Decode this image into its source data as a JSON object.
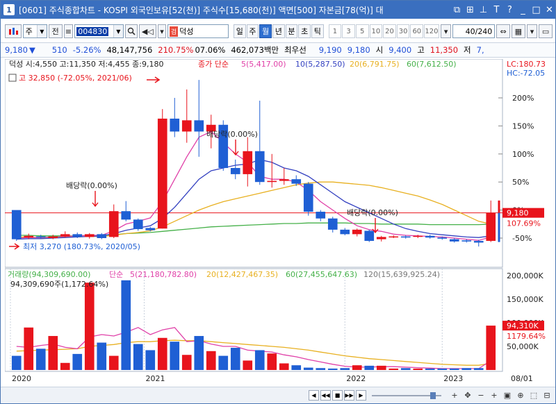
{
  "window": {
    "number": "1",
    "title": "[0601] 주식종합차트 - KOSPI 외국인보유[52(천)] 주식수[15,680(천)] 액면[500] 자본금[78(억)] 대"
  },
  "toolbar": {
    "market_type": "주",
    "prev_label": "전",
    "stock_code": "004830",
    "stock_badge": "검",
    "stock_name": "덕성",
    "periods": [
      "일",
      "주",
      "월",
      "년",
      "분",
      "초",
      "틱"
    ],
    "active_period": "월",
    "numbers": [
      "1",
      "3",
      "5",
      "10",
      "20",
      "30",
      "60",
      "120"
    ],
    "count": "40/240"
  },
  "quote": {
    "price": "9,180",
    "change_arrow": "▼",
    "change": "510",
    "change_pct": "-5.26%",
    "volume": "48,147,756",
    "volume_ratio": "210.75%",
    "turnover": "07.06%",
    "amount": "462,073백만",
    "pref_label": "최우선",
    "ask": "9,190",
    "bid": "9,180",
    "open_label": "시",
    "open": "9,400",
    "high_label": "고",
    "high": "11,350",
    "low_label": "저",
    "low": "7,"
  },
  "legend": {
    "ohlc": "덕성 시:4,550 고:11,350 저:4,455 종:9,180",
    "close_label": "종가 단순",
    "ma5": "5(5,417.00)",
    "ma10": "10(5,287.50)",
    "ma20": "20(6,791.75)",
    "ma60": "60(7,612.50)",
    "high_note": "고 32,850 (-72.05%, 2021/06)",
    "low_note": "최저 3,270 (180.73%, 2020/05)",
    "dividend": "배당락(0.00%)",
    "lc": "LC:180.73",
    "hc": "HC:-72.05",
    "vol_title": "거래량(94,309,690.00)",
    "vol_ma_label": "단순",
    "vol_ma5": "5(21,180,782.80)",
    "vol_ma20": "20(12,427,467.35)",
    "vol_ma60": "60(27,455,647.63)",
    "vol_ma120": "120(15,639,925.24)",
    "vol_note": "94,309,690주(1,172.64%)"
  },
  "colors": {
    "up": "#e8141c",
    "down": "#1f5fd4",
    "ma5": "#e040a8",
    "ma10": "#3340c0",
    "ma20": "#e8b020",
    "ma60": "#44b048",
    "ma120": "#777777",
    "price_line": "#e8141c"
  },
  "chart_data": {
    "type": "candlestick",
    "x_labels": [
      "2020",
      "2021",
      "2022",
      "2023",
      "08/01"
    ],
    "price_axis": [
      "200%",
      "150%",
      "100%",
      "50%",
      "0%",
      "-50%"
    ],
    "current_price_label": "9,180",
    "current_pct_label": "107.69%",
    "volume_axis": [
      "200,000K",
      "150,000K",
      "100,000K",
      "50,000K"
    ],
    "current_volume_label": "94,310K",
    "current_volume_pct": "1179.64%",
    "candles": [
      {
        "o": 0.0,
        "c": -52,
        "h": -46,
        "l": -55
      },
      {
        "o": -49,
        "c": -46,
        "h": -42,
        "l": -52
      },
      {
        "o": -47,
        "c": -49,
        "h": -44,
        "l": -51
      },
      {
        "o": -50,
        "c": -47,
        "h": -44,
        "l": -52
      },
      {
        "o": -47,
        "c": -43,
        "h": -38,
        "l": -49
      },
      {
        "o": -43,
        "c": -48,
        "h": -40,
        "l": -50
      },
      {
        "o": -48,
        "c": -43,
        "h": -41,
        "l": -51
      },
      {
        "o": -43,
        "c": -50,
        "h": -41,
        "l": -52
      },
      {
        "o": -48,
        "c": -2,
        "h": 10,
        "l": -50
      },
      {
        "o": -2,
        "c": -17,
        "h": 16,
        "l": -20
      },
      {
        "o": -17,
        "c": -34,
        "h": -15,
        "l": -37
      },
      {
        "o": -32,
        "c": -36,
        "h": -30,
        "l": -38
      },
      {
        "o": -33,
        "c": 163,
        "h": 180,
        "l": -33
      },
      {
        "o": 163,
        "c": 140,
        "h": 200,
        "l": 130
      },
      {
        "o": 140,
        "c": 160,
        "h": 215,
        "l": 120
      },
      {
        "o": 160,
        "c": 140,
        "h": 232,
        "l": 95
      },
      {
        "o": 140,
        "c": 152,
        "h": 170,
        "l": 110
      },
      {
        "o": 152,
        "c": 75,
        "h": 160,
        "l": 70
      },
      {
        "o": 75,
        "c": 64,
        "h": 90,
        "l": 55
      },
      {
        "o": 64,
        "c": 105,
        "h": 130,
        "l": 42
      },
      {
        "o": 105,
        "c": 50,
        "h": 195,
        "l": 45
      },
      {
        "o": 50,
        "c": 52,
        "h": 100,
        "l": 40
      },
      {
        "o": 52,
        "c": 55,
        "h": 75,
        "l": 45
      },
      {
        "o": 55,
        "c": 47,
        "h": 62,
        "l": 43
      },
      {
        "o": 47,
        "c": -3,
        "h": 50,
        "l": -10
      },
      {
        "o": -3,
        "c": -15,
        "h": 0,
        "l": -20
      },
      {
        "o": -15,
        "c": -35,
        "h": -12,
        "l": -40
      },
      {
        "o": -35,
        "c": -43,
        "h": -32,
        "l": -45
      },
      {
        "o": -43,
        "c": -35,
        "h": -33,
        "l": -47
      },
      {
        "o": -37,
        "c": -55,
        "h": -35,
        "l": -57
      },
      {
        "o": -52,
        "c": -48,
        "h": -46,
        "l": -56
      },
      {
        "o": -48,
        "c": -47,
        "h": -45,
        "l": -50
      },
      {
        "o": -47,
        "c": -49,
        "h": -45,
        "l": -51
      },
      {
        "o": -47,
        "c": -46,
        "h": -44,
        "l": -50
      },
      {
        "o": -46,
        "c": -49,
        "h": -44,
        "l": -51
      },
      {
        "o": -49,
        "c": -51,
        "h": -47,
        "l": -53
      },
      {
        "o": -52,
        "c": -56,
        "h": -50,
        "l": -58
      },
      {
        "o": -54,
        "c": -56,
        "h": -52,
        "l": -58
      },
      {
        "o": -55,
        "c": -58,
        "h": -53,
        "l": -65
      },
      {
        "o": -55,
        "c": -5,
        "h": 17,
        "l": -57
      }
    ],
    "volumes": [
      30,
      90,
      45,
      72,
      15,
      34,
      185,
      58,
      30,
      190,
      55,
      42,
      68,
      60,
      32,
      72,
      40,
      30,
      47,
      20,
      42,
      35,
      14,
      10,
      5,
      4,
      3,
      4,
      10,
      9,
      9,
      3,
      4,
      3,
      3,
      3,
      3,
      4,
      4,
      94
    ],
    "ma5": [
      -50,
      -49,
      -49,
      -48,
      -47,
      -46,
      -45,
      -45,
      -37,
      -25,
      -20,
      -14,
      15,
      55,
      95,
      130,
      140,
      120,
      100,
      85,
      60,
      55,
      55,
      50,
      35,
      15,
      0,
      -15,
      -28,
      -35,
      -38,
      -43,
      -45,
      -46,
      -47,
      -48,
      -50,
      -52,
      -54,
      -48
    ],
    "ma10": [
      -52,
      -51,
      -51,
      -50,
      -49,
      -48,
      -47,
      -46,
      -42,
      -36,
      -32,
      -28,
      -15,
      5,
      30,
      55,
      70,
      75,
      80,
      82,
      90,
      85,
      75,
      70,
      60,
      45,
      30,
      15,
      5,
      -5,
      -15,
      -25,
      -33,
      -38,
      -42,
      -44,
      -46,
      -48,
      -49,
      -46
    ],
    "ma20": [
      -48,
      -48,
      -49,
      -49,
      -48,
      -48,
      -47,
      -47,
      -45,
      -42,
      -40,
      -37,
      -30,
      -20,
      -10,
      0,
      8,
      15,
      20,
      25,
      30,
      35,
      40,
      45,
      48,
      50,
      50,
      48,
      46,
      44,
      40,
      35,
      30,
      25,
      18,
      10,
      0,
      -10,
      -20,
      -25
    ],
    "ma60": [
      -45,
      -45,
      -46,
      -46,
      -46,
      -46,
      -45,
      -45,
      -44,
      -42,
      -41,
      -40,
      -38,
      -36,
      -34,
      -32,
      -30,
      -29,
      -28,
      -27,
      -26,
      -25,
      -24,
      -24,
      -23,
      -23,
      -23,
      -23,
      -24,
      -24,
      -25,
      -25,
      -25,
      -25,
      -26,
      -26,
      -26,
      -26,
      -26,
      -25
    ],
    "vma5": [
      50,
      48,
      52,
      55,
      48,
      45,
      70,
      75,
      72,
      80,
      90,
      75,
      85,
      90,
      60,
      62,
      55,
      50,
      50,
      42,
      40,
      38,
      32,
      28,
      22,
      17,
      12,
      8,
      6,
      6,
      7,
      7,
      6,
      5,
      4,
      3,
      3,
      3,
      3,
      20
    ],
    "vma20": [
      40,
      41,
      42,
      43,
      44,
      45,
      50,
      52,
      54,
      58,
      60,
      60,
      62,
      63,
      62,
      62,
      60,
      58,
      56,
      54,
      52,
      50,
      48,
      45,
      42,
      38,
      34,
      30,
      27,
      24,
      22,
      20,
      18,
      16,
      14,
      12,
      11,
      10,
      10,
      14
    ]
  },
  "bottom": {
    "nav": [
      "◀",
      "◀◀",
      "■",
      "▶▶",
      "▶"
    ],
    "tools": [
      "+",
      "✥",
      "−",
      "+",
      "▣",
      "⊕",
      "⬚",
      "⊟"
    ]
  }
}
